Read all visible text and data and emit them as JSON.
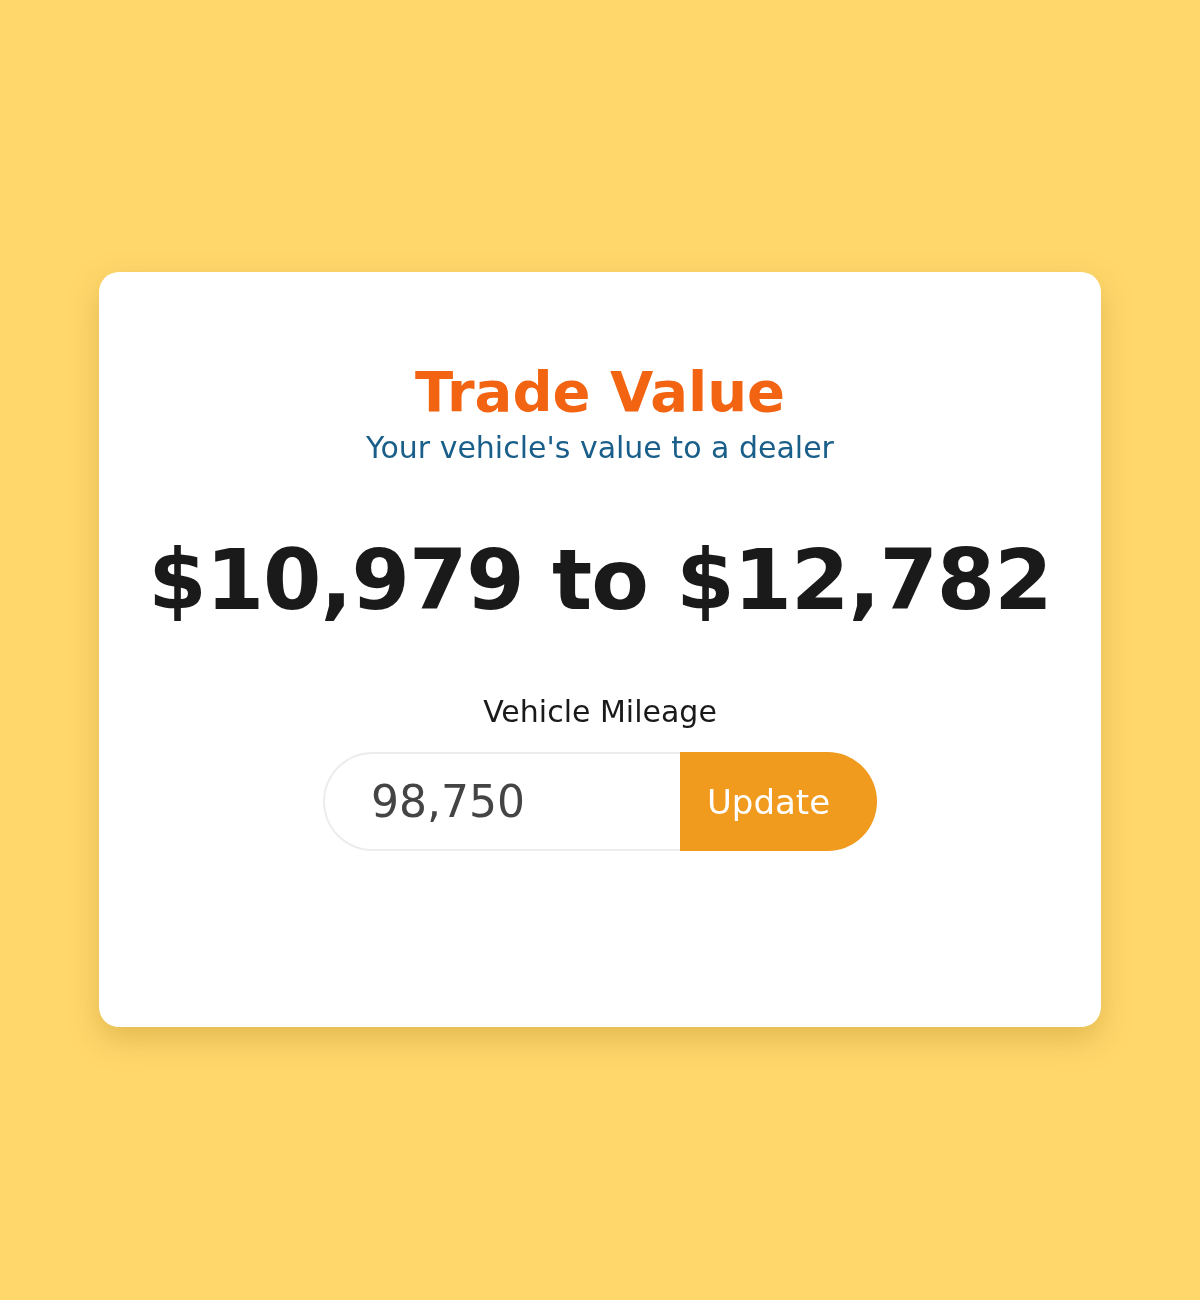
{
  "card": {
    "title": "Trade Value",
    "subtitle": "Your vehicle's value to a dealer",
    "price_range": "$10,979 to $12,782"
  },
  "mileage": {
    "label": "Vehicle Mileage",
    "value": "98,750",
    "button": "Update"
  }
}
